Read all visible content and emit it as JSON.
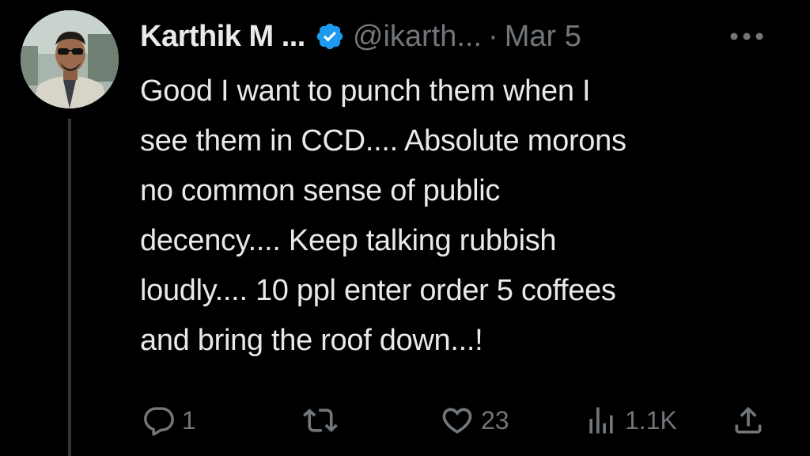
{
  "author": {
    "name": "Karthik M ...",
    "handle": "@ikarth...",
    "separator": "·",
    "date": "Mar 5",
    "verified_color": "#1d9bf0"
  },
  "tweet": {
    "lines": [
      "Good I want to punch them when I",
      "see them in CCD.... Absolute morons",
      "no common sense of public",
      "decency.... Keep talking rubbish",
      "loudly.... 10 ppl enter order 5 coffees",
      "and bring the roof down...!"
    ]
  },
  "actions": {
    "reply": {
      "icon": "reply-icon",
      "count": "1"
    },
    "retweet": {
      "icon": "retweet-icon",
      "count": ""
    },
    "like": {
      "icon": "heart-icon",
      "count": "23"
    },
    "views": {
      "icon": "views-icon",
      "count": "1.1K"
    },
    "share": {
      "icon": "share-icon"
    }
  },
  "colors": {
    "background": "#000000",
    "text": "#e7e9ea",
    "muted": "#71767b",
    "thread_line": "#333639"
  }
}
